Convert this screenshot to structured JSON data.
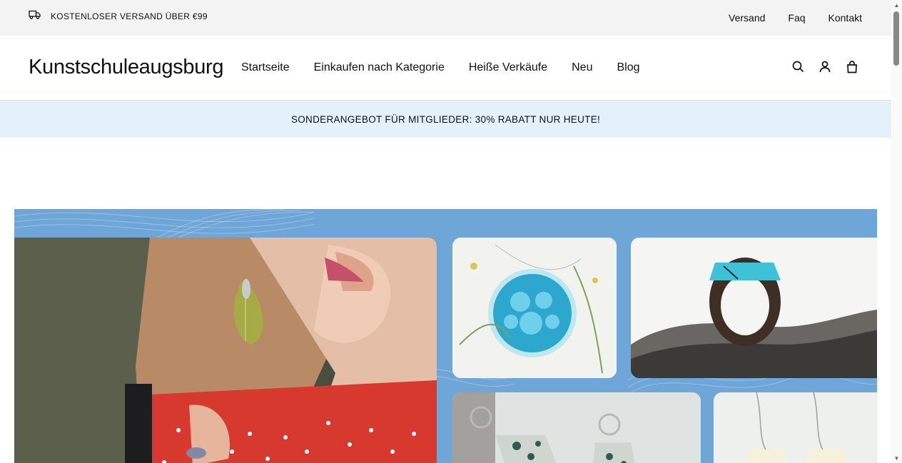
{
  "topbar": {
    "shipping_text": "KOSTENLOSER VERSAND ÜBER €99",
    "shipping_icon": "truck-icon",
    "links": [
      "Versand",
      "Faq",
      "Kontakt"
    ]
  },
  "header": {
    "logo": "Kunstschuleaugsburg",
    "nav": [
      "Startseite",
      "Einkaufen nach Kategorie",
      "Heiße Verkäufe",
      "Neu",
      "Blog"
    ],
    "icons": [
      "search-icon",
      "account-icon",
      "cart-bag-icon"
    ]
  },
  "promo": {
    "text": "SONDERANGEBOT FÜR MITGLIEDER: 30% RABATT NUR HEUTE!"
  },
  "hero": {
    "background_color": "#6fa6d8",
    "images": [
      "woman-with-leaf-earrings",
      "blue-flower-resin-pendant",
      "wood-resin-ring",
      "moss-agate-earrings",
      "resin-flower-earrings"
    ]
  },
  "colors": {
    "topbar_bg": "#f3f3f3",
    "promo_bg": "#e4f0fa",
    "text": "#111111"
  }
}
